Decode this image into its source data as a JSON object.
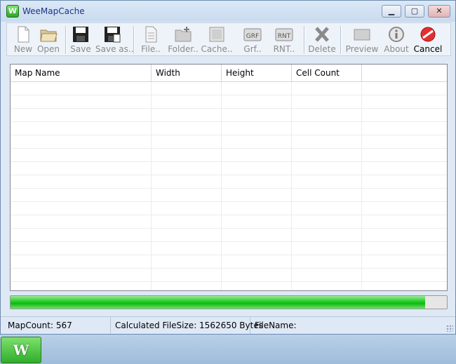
{
  "window": {
    "title": "WeeMapCache"
  },
  "title_buttons": {
    "minimize": "▁",
    "maximize": "▢",
    "close": "✕"
  },
  "toolbar": {
    "new": "New",
    "open": "Open",
    "save": "Save",
    "save_as": "Save as..",
    "file": "File..",
    "folder": "Folder..",
    "cache": "Cache..",
    "grf": "Grf..",
    "rnt": "RNT..",
    "delete": "Delete",
    "preview": "Preview",
    "about": "About",
    "cancel": "Cancel",
    "grf_icon_text": "GRF",
    "rnt_icon_text": "RNT"
  },
  "grid": {
    "columns": [
      "Map Name",
      "Width",
      "Height",
      "Cell Count"
    ],
    "rows": []
  },
  "progress": {
    "fraction": 0.95,
    "color": "#11b811"
  },
  "status": {
    "map_count": "MapCount: 567",
    "file_size": "Calculated FileSize: 1562650 Bytes",
    "file_name": "FileName:"
  },
  "taskbar": {
    "app_glyph": "W"
  },
  "app_icon_glyph": "W"
}
